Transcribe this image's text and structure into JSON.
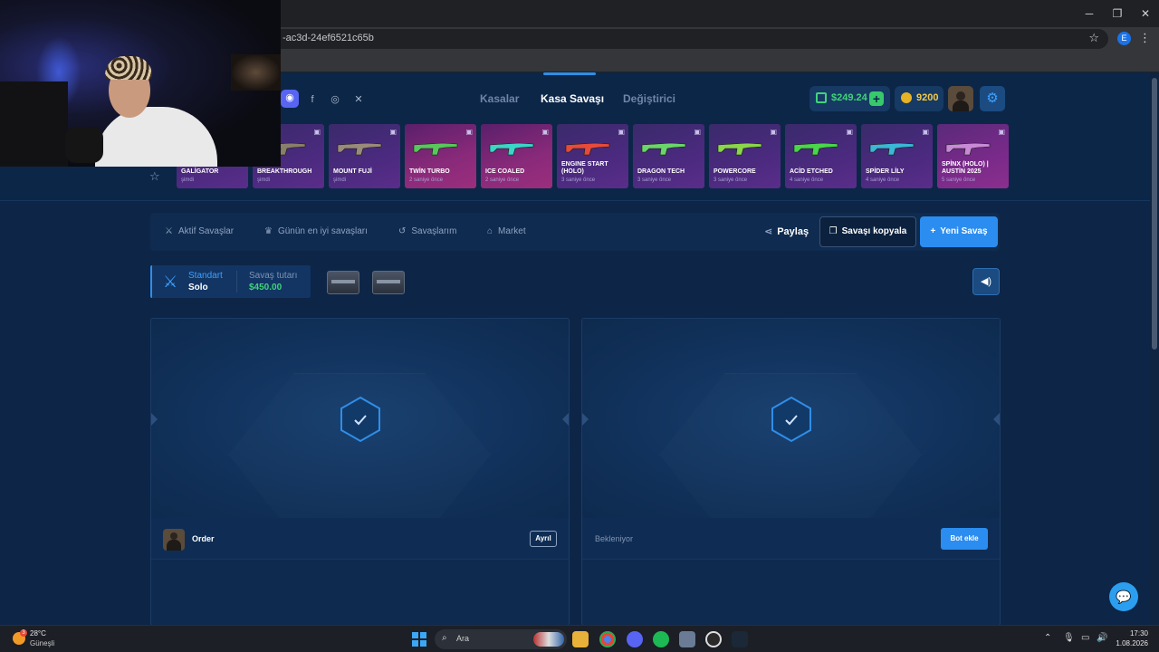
{
  "browser": {
    "url_fragment": "-ac3d-24ef6521c65b",
    "profile_initial": "E",
    "window_controls": [
      "─",
      "❐",
      "✕"
    ]
  },
  "header": {
    "nav": [
      "Kasalar",
      "Kasa Savaşı",
      "Değiştirici"
    ],
    "active_nav": "Kasa Savaşı",
    "balance": "$249.24",
    "coins": "9200"
  },
  "drops": [
    {
      "name": "GALİGATOR",
      "time": "şimdi",
      "gun_color": "#7a6a5a"
    },
    {
      "name": "BREAKTHROUGH",
      "time": "şimdi",
      "gun_color": "#8a7f6a"
    },
    {
      "name": "MOUNT FUJİ",
      "time": "şimdi",
      "gun_color": "#9a8a7a"
    },
    {
      "name": "TWİN TURBO",
      "time": "2 saniye önce",
      "gun_color": "#58c85a"
    },
    {
      "name": "ICE COALED",
      "time": "2 saniye önce",
      "gun_color": "#3ad6c8"
    },
    {
      "name": "ENGINE START (HOLO)",
      "time": "3 saniye önce",
      "gun_color": "#e84a3a"
    },
    {
      "name": "DRAGON TECH",
      "time": "3 saniye önce",
      "gun_color": "#6ad66a"
    },
    {
      "name": "POWERCORE",
      "time": "3 saniye önce",
      "gun_color": "#8ad64a"
    },
    {
      "name": "ACİD ETCHED",
      "time": "4 saniye önce",
      "gun_color": "#4ad64a"
    },
    {
      "name": "SPİDER LİLY",
      "time": "4 saniye önce",
      "gun_color": "#3ab8d6"
    },
    {
      "name": "SPİNX (HOLO) | AUSTİN 2025",
      "time": "5 saniye önce",
      "gun_color": "#c88ad6"
    }
  ],
  "toolbar": {
    "tabs": [
      "Aktif Savaşlar",
      "Günün en iyi savaşları",
      "Savaşlarım",
      "Market"
    ],
    "share": "Paylaş",
    "copy": "Savaşı kopyala",
    "new": "Yeni Savaş"
  },
  "battle": {
    "mode_label": "Standart",
    "mode_value": "Solo",
    "cost_label": "Savaş tutarı",
    "cost_value": "$450.00"
  },
  "players": {
    "p1_name": "Order",
    "p1_leave": "Ayrıl",
    "p2_status": "Bekleniyor",
    "p2_bot": "Bot ekle"
  },
  "taskbar": {
    "temp": "28°C",
    "condition": "Güneşli",
    "search": "Ara",
    "time": "17:30",
    "date": "1.08.2026",
    "weather_badge": "3"
  }
}
